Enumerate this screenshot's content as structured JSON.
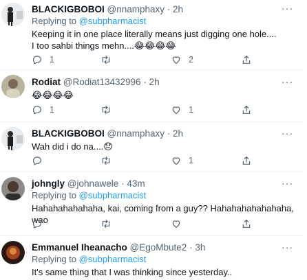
{
  "tweets": [
    {
      "name": "BLACKIGBOBOI",
      "handle": "@nnamphaxy",
      "time": "2h",
      "replying_prefix": "Replying to ",
      "replying_to": "@subpharmacist",
      "lines": [
        "Keeping it in one place literally means just digging one hole....",
        "I too sahbi things mehn....😂😂😂😂"
      ],
      "replies": "1",
      "retweets": "",
      "likes": "2"
    },
    {
      "name": "Rodiat",
      "handle": "@Rodiat13432996",
      "time": "2h",
      "lines": [
        "😂😂😂😂"
      ],
      "replies": "1",
      "retweets": "",
      "likes": "1"
    },
    {
      "name": "BLACKIGBOBOI",
      "handle": "@nnamphaxy",
      "time": "2h",
      "lines": [
        "Wah did i do na....😞"
      ],
      "replies": "",
      "retweets": "",
      "likes": "1"
    },
    {
      "name": "johngly",
      "handle": "@johnawele",
      "time": "43m",
      "replying_prefix": "Replying to ",
      "replying_to": "@subpharmacist",
      "lines": [
        "Hahahahahahaha, kai, coming from a guy?? Hahahahahahahaha, wao"
      ],
      "replies": "",
      "retweets": "",
      "likes": ""
    },
    {
      "name": "Emmanuel Iheanacho",
      "handle": "@EgoMbute2",
      "time": "3h",
      "replying_prefix": "Replying to ",
      "replying_to": "@subpharmacist",
      "lines": [
        "It's same thing that I was thinking since yesterday.."
      ]
    }
  ],
  "dot": "·",
  "more_glyph": "···",
  "colors": {
    "accent": "#1d9bf0",
    "secondary": "#536471",
    "divider": "#eff3f4"
  },
  "icons": [
    "reply-icon",
    "retweet-icon",
    "like-icon",
    "share-icon",
    "more-icon",
    "avatar"
  ]
}
